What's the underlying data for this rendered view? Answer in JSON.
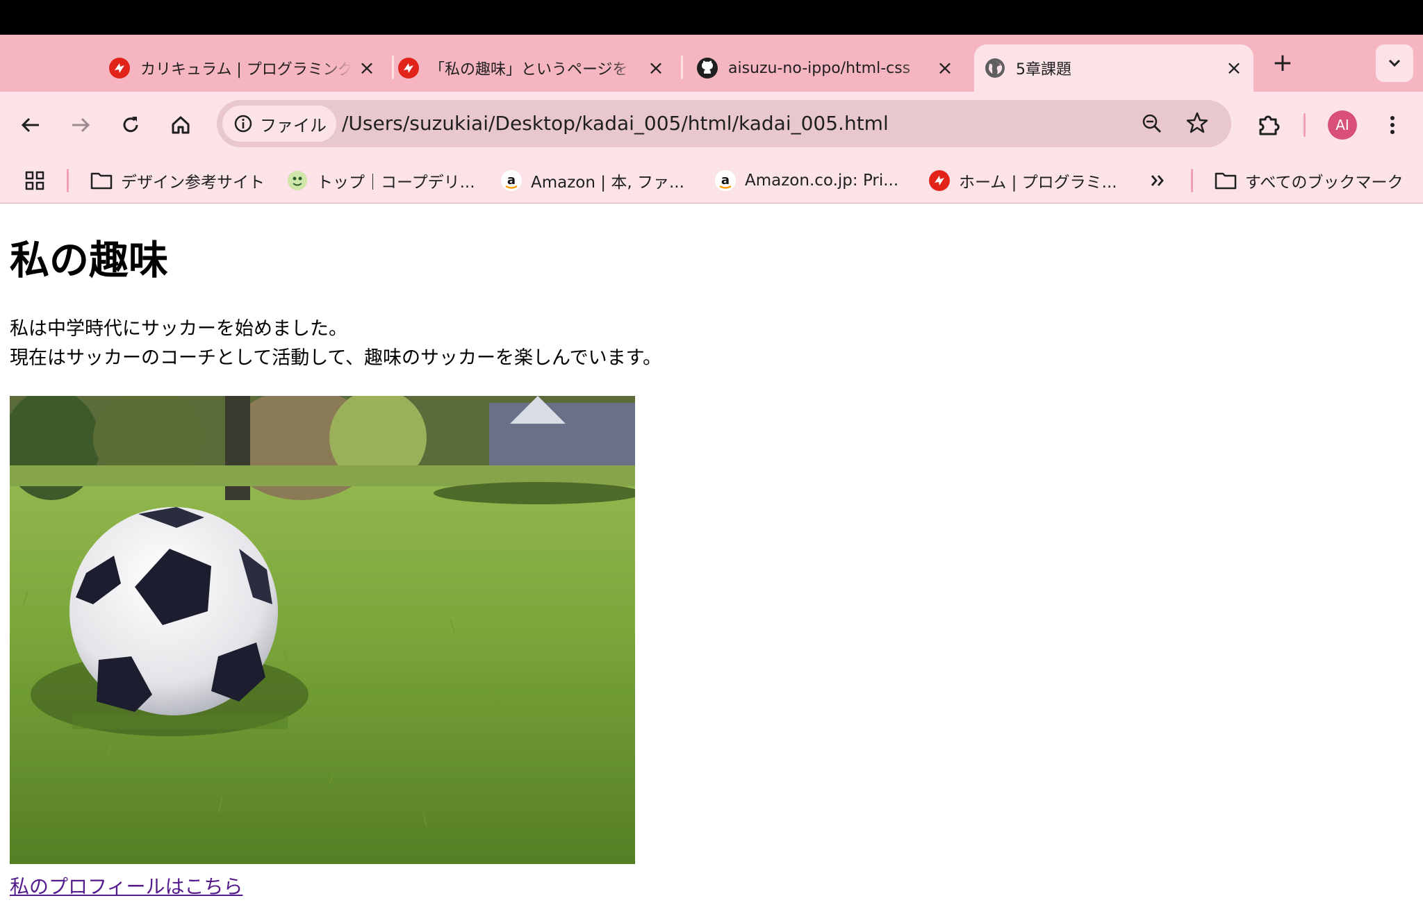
{
  "tabs": [
    {
      "title": "カリキュラム | プログラミング",
      "icon": "samurai-logo-icon"
    },
    {
      "title": "「私の趣味」というページを",
      "icon": "samurai-logo-icon"
    },
    {
      "title": "aisuzu-no-ippo/html-css",
      "icon": "github-icon"
    },
    {
      "title": "5章課題",
      "icon": "globe-icon"
    }
  ],
  "toolbar": {
    "site_info_label": "ファイル",
    "url": "/Users/suzukiai/Desktop/kadai_005/html/kadai_005.html",
    "avatar_initials": "AI"
  },
  "bookmarks": {
    "items": [
      {
        "label": "デザイン参考サイト",
        "icon": "folder-icon"
      },
      {
        "label": "トップ｜コープデリ...",
        "icon": "coop-logo-icon"
      },
      {
        "label": "Amazon | 本, ファ...",
        "icon": "amazon-icon"
      },
      {
        "label": "Amazon.co.jp: Pri...",
        "icon": "amazon-icon"
      },
      {
        "label": "ホーム | プログラミ...",
        "icon": "samurai-logo-icon"
      }
    ],
    "all_bookmarks": "すべてのブックマーク"
  },
  "page": {
    "heading": "私の趣味",
    "line1": "私は中学時代にサッカーを始めました。",
    "line2": "現在はサッカーのコーチとして活動して、趣味のサッカーを楽しんでいます。",
    "link": "私のプロフィールはこちら"
  },
  "colors": {
    "tabstrip": "#f5b5c1",
    "toolbar": "#fbe3e8",
    "link": "#551a8b",
    "avatar": "#d9507a"
  }
}
